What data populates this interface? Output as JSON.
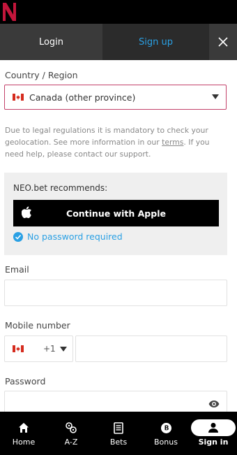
{
  "tabs": {
    "login": "Login",
    "signup": "Sign up"
  },
  "country": {
    "label": "Country / Region",
    "value": "Canada (other province)",
    "flag": "canada-flag"
  },
  "info": {
    "text_before": "Due to legal regulations it is mandatory to check your geolocation. See more information in our ",
    "link": "terms",
    "text_after": ". If you need help, please contact our support."
  },
  "recommend": {
    "title": "NEO.bet recommends:",
    "apple_button": "Continue with Apple",
    "no_password": "No password required"
  },
  "email": {
    "label": "Email",
    "value": ""
  },
  "mobile": {
    "label": "Mobile number",
    "prefix": "+1",
    "value": ""
  },
  "password": {
    "label": "Password",
    "value": ""
  },
  "nav": [
    {
      "label": "Home",
      "icon": "home-icon"
    },
    {
      "label": "A-Z",
      "icon": "az-icon"
    },
    {
      "label": "Bets",
      "icon": "bets-icon"
    },
    {
      "label": "Bonus",
      "icon": "bonus-icon"
    },
    {
      "label": "Sign in",
      "icon": "user-icon"
    }
  ],
  "colors": {
    "accent": "#2aa0e4",
    "brand": "#c3163b",
    "focus_border": "#c3416a"
  }
}
